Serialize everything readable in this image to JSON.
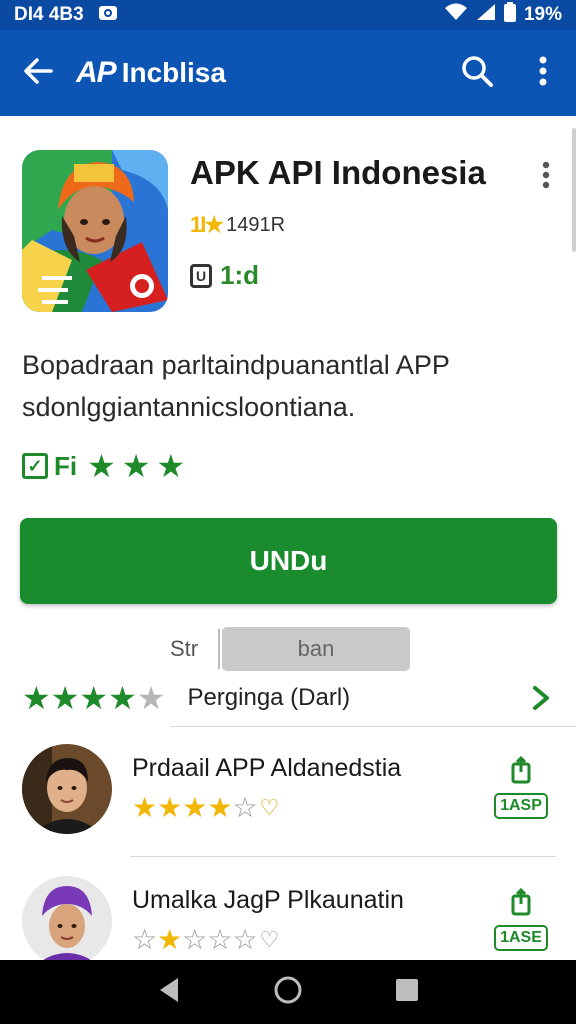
{
  "status_bar": {
    "time": "DI4 4B3",
    "battery": "19%"
  },
  "app_bar": {
    "logo": "AP",
    "title": "Incblisa",
    "back_icon": "arrow-left-icon",
    "search_icon": "search-icon",
    "more_icon": "more-vert-icon"
  },
  "app": {
    "name": "APK API Indonesia",
    "rating_stars": "1I★",
    "rating_text": "1491R",
    "meta_value": "1:d",
    "icon": "app-icon-girl-map",
    "description": "Bopadraan parltaindpuanantlal APP sdonlggiantannicsloontiana."
  },
  "badges": {
    "label": "Fi",
    "star_count": 3
  },
  "download": {
    "label": "UNDu"
  },
  "toggle": {
    "option_a": "Str",
    "option_b": "ban"
  },
  "rating_summary": {
    "stars": 4,
    "label": "Perginga (Darl)"
  },
  "reviews": [
    {
      "name": "Prdaail APP Aldanedstia",
      "stars": 4,
      "action_label": "1ASP"
    },
    {
      "name": "Umalka JagP Plkaunatin",
      "stars": 1,
      "action_label": "1ASE"
    }
  ],
  "colors": {
    "app_bar": "#0d55b4",
    "status_bar": "#0a4aa3",
    "accent_green": "#1a8c2e",
    "star_yellow": "#f2b705"
  }
}
